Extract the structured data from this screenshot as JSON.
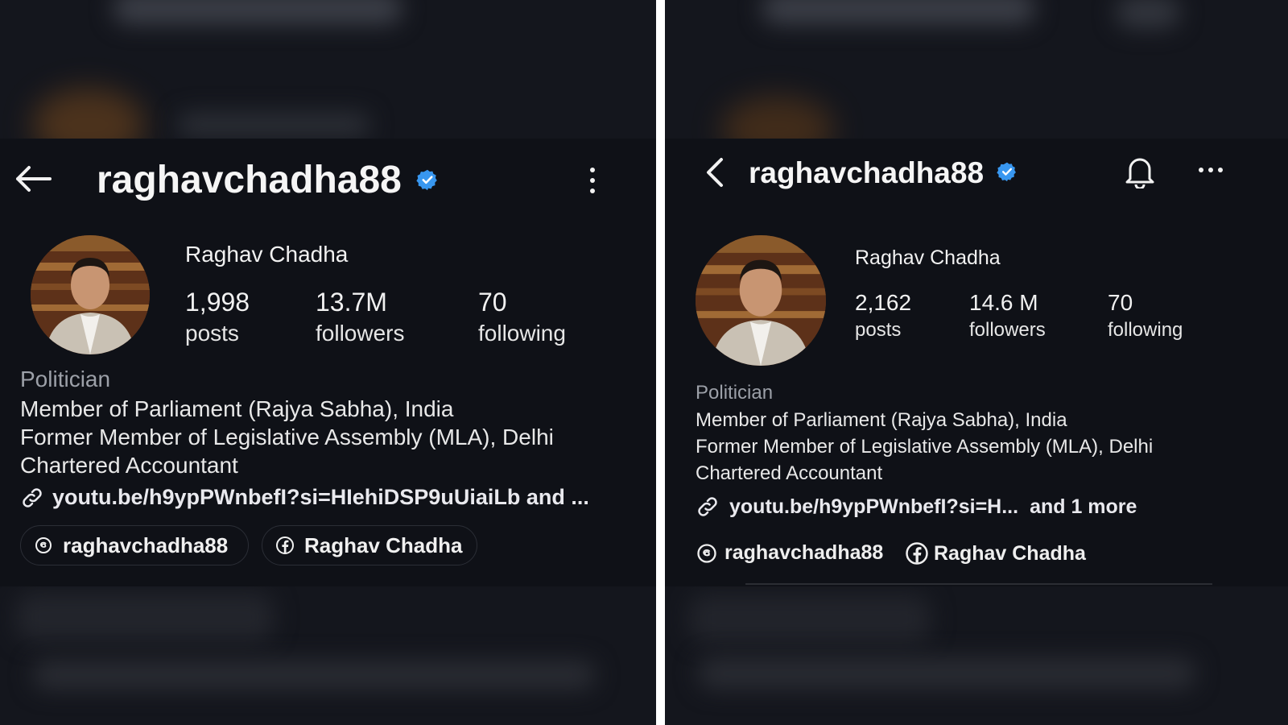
{
  "left": {
    "handle": "raghavchadha88",
    "display_name": "Raghav Chadha",
    "stats": [
      {
        "value": "1,998",
        "label": "posts"
      },
      {
        "value": "13.7M",
        "label": "followers"
      },
      {
        "value": "70",
        "label": "following"
      }
    ],
    "category": "Politician",
    "bio": [
      "Member of Parliament (Rajya Sabha), India",
      "Former Member of Legislative Assembly (MLA), Delhi",
      "Chartered Accountant"
    ],
    "link_text": "youtu.be/h9ypPWnbefI?si=HIehiDSP9uUiaiLb and ...",
    "threads_label": "raghavchadha88",
    "facebook_label": "Raghav Chadha"
  },
  "right": {
    "handle": "raghavchadha88",
    "display_name": "Raghav Chadha",
    "stats": [
      {
        "value": "2,162",
        "label": "posts"
      },
      {
        "value": "14.6 M",
        "label": "followers"
      },
      {
        "value": "70",
        "label": "following"
      }
    ],
    "category": "Politician",
    "bio": [
      "Member of Parliament (Rajya Sabha), India",
      "Former Member of Legislative Assembly (MLA), Delhi",
      "Chartered Accountant"
    ],
    "link_text": "youtu.be/h9ypPWnbefI?si=H...",
    "link_more": "and 1 more",
    "threads_label": "raghavchadha88",
    "facebook_label": "Raghav Chadha"
  },
  "colors": {
    "verified_badge": "#3897f0",
    "background": "#0f1117",
    "divider": "#ffffff"
  },
  "icons": [
    "back-arrow-icon",
    "verified-badge-icon",
    "more-vertical-icon",
    "back-chevron-icon",
    "bell-icon",
    "more-horizontal-icon",
    "link-icon",
    "threads-icon",
    "facebook-icon"
  ]
}
